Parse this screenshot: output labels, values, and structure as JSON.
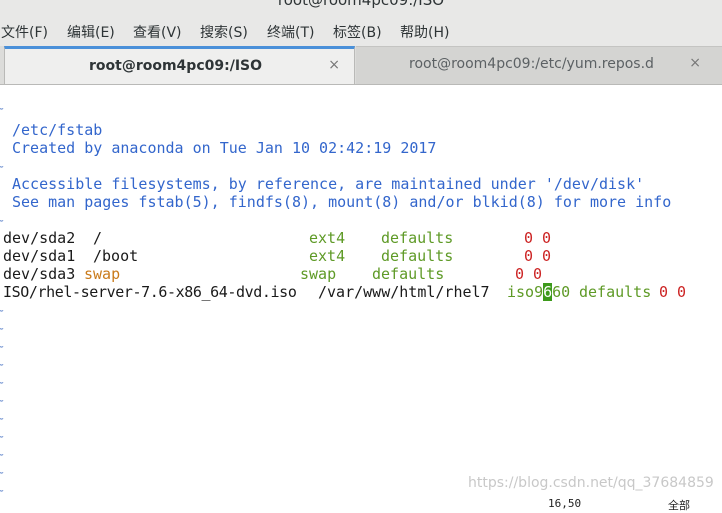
{
  "window": {
    "title": "root@room4pc09:/ISO"
  },
  "menu": {
    "items": [
      {
        "label": "文件(F)"
      },
      {
        "label": "编辑(E)"
      },
      {
        "label": "查看(V)"
      },
      {
        "label": "搜索(S)"
      },
      {
        "label": "终端(T)"
      },
      {
        "label": "标签(B)"
      },
      {
        "label": "帮助(H)"
      }
    ]
  },
  "tabs": [
    {
      "label": "root@room4pc09:/ISO",
      "close": "×",
      "active": true
    },
    {
      "label": "root@room4pc09:/etc/yum.repos.d",
      "close": "×",
      "active": false
    }
  ],
  "editor": {
    "comment1": "/etc/fstab",
    "comment2": "Created by anaconda on Tue Jan 10 02:42:19 2017",
    "comment3": "Accessible filesystems, by reference, are maintained under '/dev/disk'",
    "comment4": "See man pages fstab(5), findfs(8), mount(8) and/or blkid(8) for more info",
    "row1": {
      "dev": "dev/sda2",
      "mount": "/",
      "type": "ext4",
      "opts": "defaults",
      "nums": "0 0"
    },
    "row2": {
      "dev": "dev/sda1",
      "mount": "/boot",
      "type": "ext4",
      "opts": "defaults",
      "nums": "0 0"
    },
    "row3": {
      "dev": "dev/sda3",
      "mount": "swap",
      "type": "swap",
      "opts": "defaults",
      "nums": "0 0"
    },
    "row4": {
      "dev": "ISO/rhel-server-7.6-x86_64-dvd.iso",
      "mount": "/var/www/html/rhel7",
      "type_a": "iso9",
      "type_cursor": "6",
      "type_b": "60",
      "opts": "defaults",
      "nums": "0 0"
    },
    "tilde": "~"
  },
  "watermark": "https://blog.csdn.net/qq_37684859",
  "status": {
    "left": "16,50",
    "right": "全部"
  },
  "colors": {
    "comment": "#3366cc",
    "type": "#5e9a26",
    "number": "#cc2222",
    "swap": "#c97a1a",
    "cursor": "#3d9a1b",
    "tab_accent": "#4a90d9"
  }
}
